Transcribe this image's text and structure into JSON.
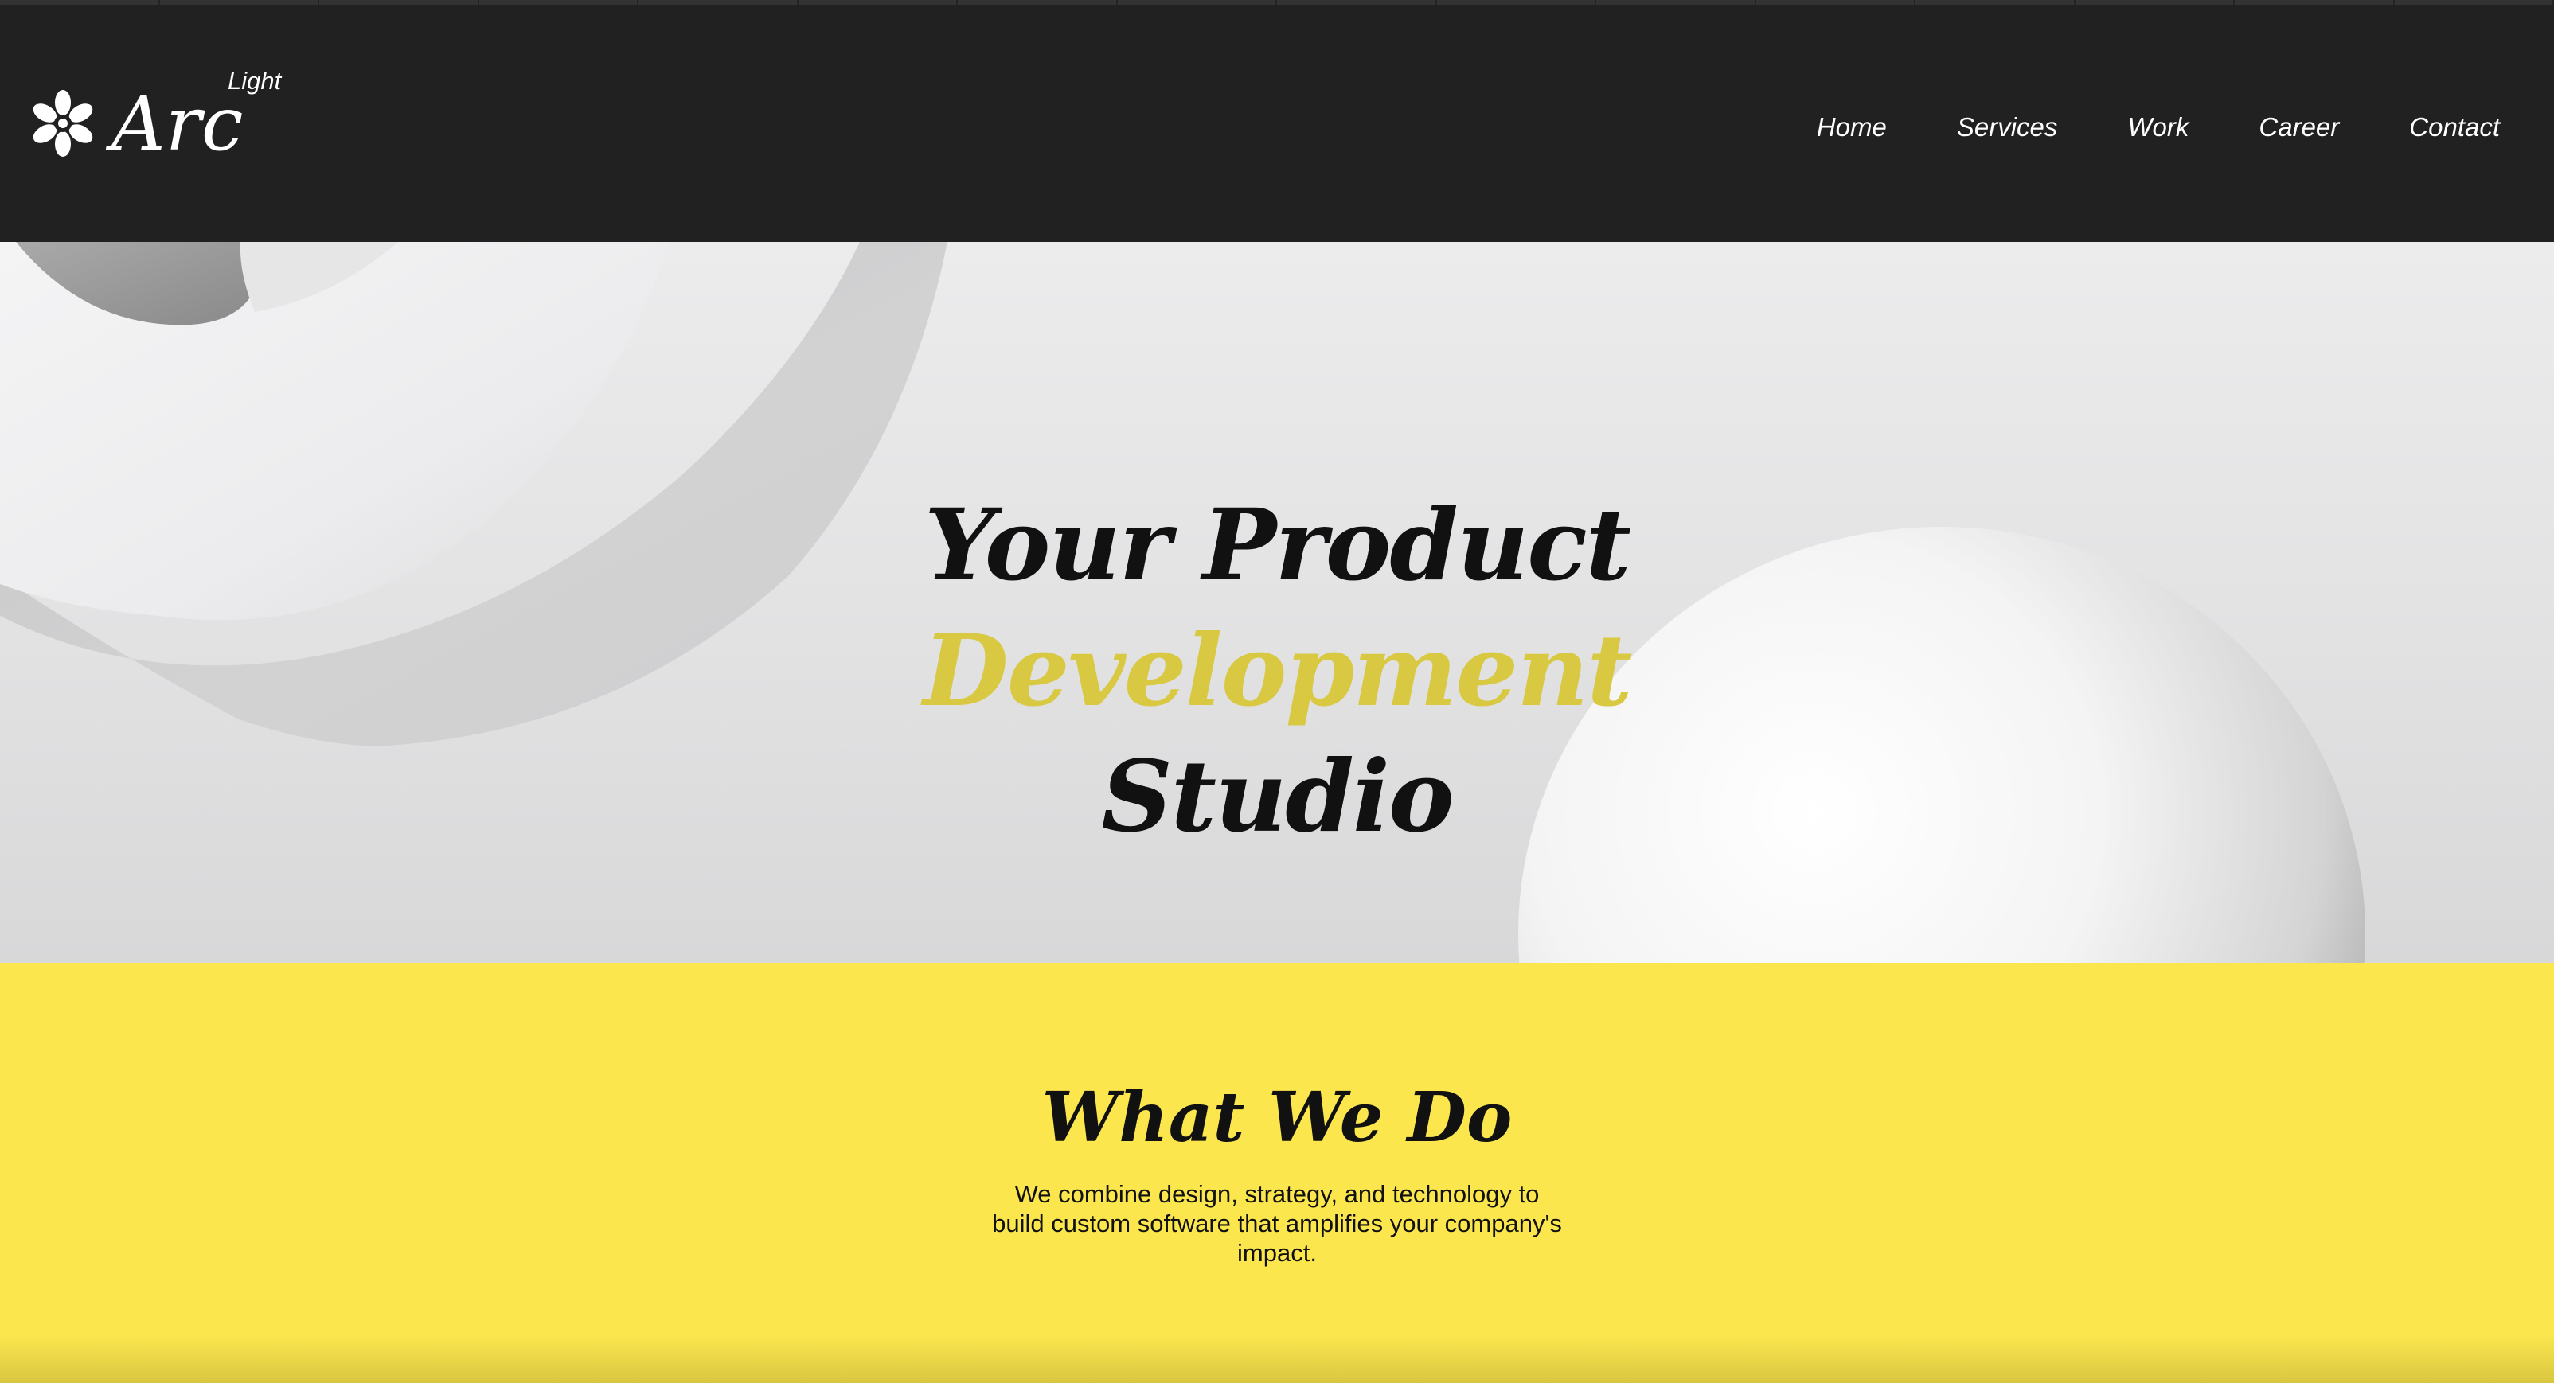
{
  "header": {
    "logo": {
      "wordmark": "Arc",
      "tagline": "Light",
      "icon": "flower-asterisk-icon"
    },
    "nav": [
      {
        "label": "Home"
      },
      {
        "label": "Services"
      },
      {
        "label": "Work"
      },
      {
        "label": "Career"
      },
      {
        "label": "Contact"
      }
    ]
  },
  "hero": {
    "headline_line1": "Your Product",
    "headline_accent": "Development",
    "headline_line3": "Studio"
  },
  "what_we_do": {
    "title": "What We Do",
    "description": "We combine design, strategy, and technology to build custom software that amplifies your company's impact."
  },
  "colors": {
    "header_bg": "#212121",
    "accent_yellow": "#fbe64e",
    "accent_text": "#d9c842",
    "hero_bg": "#e4e4e5"
  }
}
